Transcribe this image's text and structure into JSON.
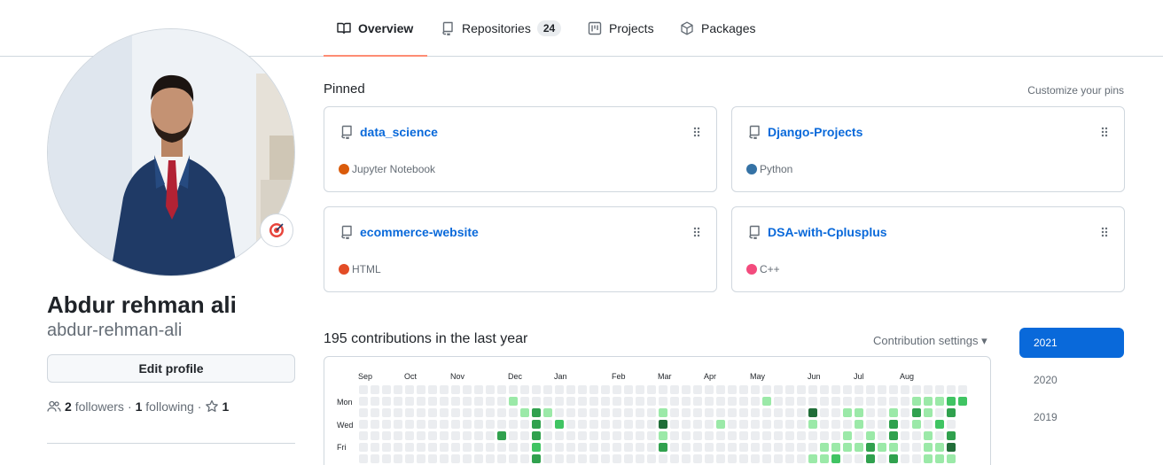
{
  "tabs": [
    {
      "label": "Overview",
      "icon": "book-icon",
      "active": true
    },
    {
      "label": "Repositories",
      "icon": "repo-icon",
      "count": "24"
    },
    {
      "label": "Projects",
      "icon": "project-icon"
    },
    {
      "label": "Packages",
      "icon": "package-icon"
    }
  ],
  "profile": {
    "full_name": "Abdur rehman ali",
    "username": "abdur-rehman-ali",
    "edit_label": "Edit profile",
    "followers_count": "2",
    "followers_label": "followers",
    "following_count": "1",
    "following_label": "following",
    "stars_count": "1",
    "status_icon": "target-icon"
  },
  "pinned": {
    "title": "Pinned",
    "customize_label": "Customize your pins",
    "repos": [
      {
        "name": "data_science",
        "language": "Jupyter Notebook",
        "color": "#DA5B0B"
      },
      {
        "name": "Django-Projects",
        "language": "Python",
        "color": "#3572A5"
      },
      {
        "name": "ecommerce-website",
        "language": "HTML",
        "color": "#e34c26"
      },
      {
        "name": "DSA-with-Cplusplus",
        "language": "C++",
        "color": "#f34b7d"
      }
    ]
  },
  "contributions": {
    "title": "195 contributions in the last year",
    "settings_label": "Contribution settings ▾",
    "months": [
      "Sep",
      "Oct",
      "Nov",
      "Dec",
      "Jan",
      "Feb",
      "Mar",
      "Apr",
      "May",
      "Jun",
      "Jul",
      "Aug"
    ],
    "days": [
      "Mon",
      "Wed",
      "Fri"
    ],
    "colors": [
      "#ebedf0",
      "#9be9a8",
      "#40c463",
      "#30a14e",
      "#216e39"
    ],
    "levels": [
      [
        0,
        0,
        0,
        0,
        0,
        0,
        0,
        0,
        0,
        0,
        0,
        0,
        0,
        0,
        0,
        0,
        0,
        0,
        0,
        0,
        0,
        0,
        0,
        0,
        0,
        0,
        0,
        0,
        0,
        0,
        0,
        0,
        0,
        0,
        0,
        0,
        0,
        0,
        0,
        0,
        0,
        0,
        0,
        0,
        0,
        0,
        0,
        0,
        0,
        0,
        0,
        0,
        0
      ],
      [
        0,
        0,
        0,
        0,
        0,
        0,
        0,
        0,
        0,
        0,
        0,
        0,
        0,
        1,
        0,
        0,
        0,
        0,
        0,
        0,
        0,
        0,
        0,
        0,
        0,
        0,
        0,
        0,
        0,
        0,
        0,
        0,
        0,
        0,
        0,
        1,
        0,
        0,
        0,
        0,
        0,
        0,
        0,
        0,
        0,
        0,
        0,
        0,
        1,
        1,
        1,
        2,
        2
      ],
      [
        0,
        0,
        0,
        0,
        0,
        0,
        0,
        0,
        0,
        0,
        0,
        0,
        0,
        0,
        1,
        3,
        1,
        0,
        0,
        0,
        0,
        0,
        0,
        0,
        0,
        0,
        1,
        0,
        0,
        0,
        0,
        0,
        0,
        0,
        0,
        0,
        0,
        0,
        0,
        4,
        0,
        0,
        1,
        1,
        0,
        0,
        1,
        0,
        3,
        1,
        0,
        3
      ],
      [
        0,
        0,
        0,
        0,
        0,
        0,
        0,
        0,
        0,
        0,
        0,
        0,
        0,
        0,
        0,
        3,
        0,
        2,
        0,
        0,
        0,
        0,
        0,
        0,
        0,
        0,
        4,
        0,
        0,
        0,
        0,
        1,
        0,
        0,
        0,
        0,
        0,
        0,
        0,
        1,
        0,
        0,
        0,
        1,
        0,
        0,
        3,
        0,
        1,
        0,
        2,
        0
      ],
      [
        0,
        0,
        0,
        0,
        0,
        0,
        0,
        0,
        0,
        0,
        0,
        0,
        3,
        0,
        0,
        3,
        0,
        0,
        0,
        0,
        0,
        0,
        0,
        0,
        0,
        0,
        1,
        0,
        0,
        0,
        0,
        0,
        0,
        0,
        0,
        0,
        0,
        0,
        0,
        0,
        0,
        0,
        1,
        0,
        1,
        0,
        3,
        0,
        0,
        1,
        0,
        3
      ],
      [
        0,
        0,
        0,
        0,
        0,
        0,
        0,
        0,
        0,
        0,
        0,
        0,
        0,
        0,
        0,
        2,
        0,
        0,
        0,
        0,
        0,
        0,
        0,
        0,
        0,
        0,
        3,
        0,
        0,
        0,
        0,
        0,
        0,
        0,
        0,
        0,
        0,
        0,
        0,
        0,
        1,
        1,
        1,
        1,
        3,
        1,
        1,
        0,
        0,
        1,
        1,
        4
      ],
      [
        0,
        0,
        0,
        0,
        0,
        0,
        0,
        0,
        0,
        0,
        0,
        0,
        0,
        0,
        0,
        3,
        0,
        0,
        0,
        0,
        0,
        0,
        0,
        0,
        0,
        0,
        0,
        0,
        0,
        0,
        0,
        0,
        0,
        0,
        0,
        0,
        0,
        0,
        0,
        1,
        1,
        2,
        0,
        0,
        3,
        0,
        3,
        0,
        0,
        1,
        1,
        1
      ]
    ]
  },
  "years": [
    "2021",
    "2020",
    "2019"
  ]
}
